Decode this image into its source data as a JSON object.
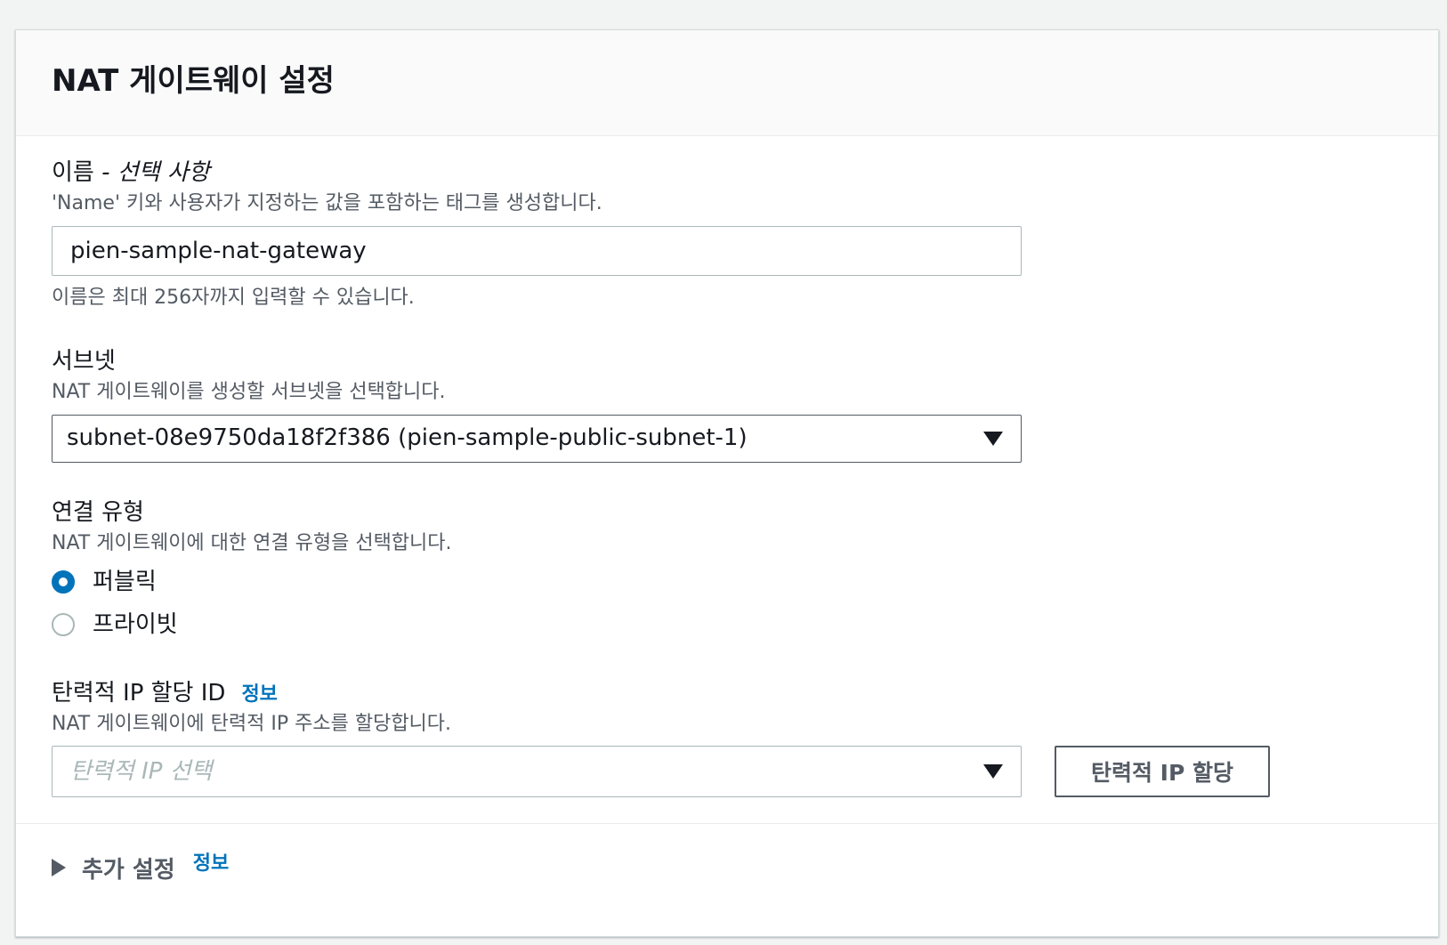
{
  "panel": {
    "title": "NAT 게이트웨이 설정"
  },
  "name_field": {
    "label": "이름",
    "optional_suffix": " - 선택 사항",
    "description": "'Name' 키와 사용자가 지정하는 값을 포함하는 태그를 생성합니다.",
    "value": "pien-sample-nat-gateway",
    "constraint": "이름은 최대 256자까지 입력할 수 있습니다."
  },
  "subnet_field": {
    "label": "서브넷",
    "description": "NAT 게이트웨이를 생성할 서브넷을 선택합니다.",
    "selected": "subnet-08e9750da18f2f386 (pien-sample-public-subnet-1)",
    "caret_icon": "caret-down-icon"
  },
  "connectivity_field": {
    "label": "연결 유형",
    "description": "NAT 게이트웨이에 대한 연결 유형을 선택합니다.",
    "options": [
      {
        "label": "퍼블릭",
        "checked": true
      },
      {
        "label": "프라이빗",
        "checked": false
      }
    ]
  },
  "eip_field": {
    "label": "탄력적 IP 할당 ID",
    "info_link": "정보",
    "description": "NAT 게이트웨이에 탄력적 IP 주소를 할당합니다.",
    "placeholder": "탄력적 IP 선택",
    "allocate_button": "탄력적 IP 할당"
  },
  "additional_settings": {
    "label": "추가 설정",
    "info_link": "정보",
    "expanded": false
  },
  "colors": {
    "accent": "#0073bb",
    "text": "#16191f",
    "secondary_text": "#545b64",
    "border": "#aab7b8"
  }
}
